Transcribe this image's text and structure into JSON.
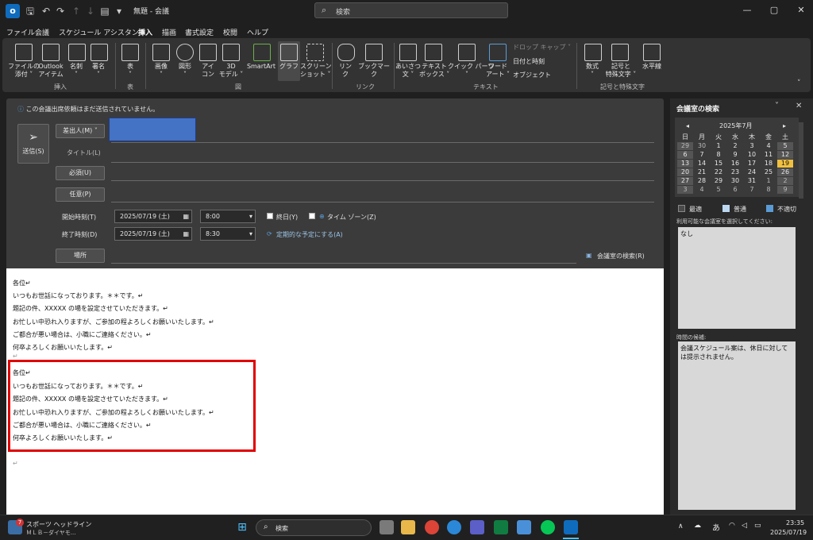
{
  "titlebar": {
    "title": "無題 - 会議",
    "search_placeholder": "検索",
    "colors": {
      "app_icon": "#0f6cbd"
    }
  },
  "menu": {
    "tabs": [
      "ファイル",
      "会議",
      "スケジュール アシスタント",
      "挿入",
      "描画",
      "書式設定",
      "校閲",
      "ヘルプ"
    ],
    "active": "挿入"
  },
  "ribbon": {
    "buttons": {
      "attach": "ファイルの\n添付 ˅",
      "outlook_item": "Outlook\nアイテム",
      "card": "名刺\n˅",
      "signature": "署名\n˅",
      "table": "表\n˅",
      "image": "画像\n˅",
      "shapes": "図形\n˅",
      "icons": "アイ\nコン",
      "model3d": "3D\nモデル ˅",
      "smartart": "SmartArt",
      "chart": "グラフ",
      "screenshot": "スクリーン\nショット ˅",
      "link": "リン\nク",
      "bookmark": "ブックマーク",
      "greeting": "あいさつ\n文 ˅",
      "textbox": "テキスト\nボックス ˅",
      "quickparts": "クイック パーツ\n˅",
      "wordart": "ワード\nアート ˅",
      "dropcap": "ドロップ キャップ ˅",
      "datetime": "日付と時刻",
      "object": "オブジェクト",
      "equation": "数式\n˅",
      "symbol": "記号と\n特殊文字 ˅",
      "hline": "水平線"
    },
    "groups": {
      "insert": "挿入",
      "table": "表",
      "figure": "図",
      "link": "リンク",
      "text": "テキスト",
      "symbols": "記号と特殊文字"
    }
  },
  "compose": {
    "info": "この会議出席依頼はまだ送信されていません。",
    "send": "送信(S)",
    "from": "差出人(M) ˅",
    "from_value_color": "#4472c4",
    "title_label": "タイトル(L)",
    "required": "必須(U)",
    "optional": "任意(P)",
    "start_label": "開始時刻(T)",
    "end_label": "終了時刻(D)",
    "start_date": "2025/07/19 (土)",
    "start_time": "8:00",
    "end_date": "2025/07/19 (土)",
    "end_time": "8:30",
    "all_day": "終日(Y)",
    "timezone": "タイム ゾーン(Z)",
    "recurring": "定期的な予定にする(A)",
    "location": "場所",
    "room_finder": "会議室の検索(R)",
    "body_lines": [
      "各位↵",
      "いつもお世話になっております。＊＊です。↵",
      "題記の件、XXXXX の場を設定させていただきます。↵",
      "お忙しい中恐れ入りますが、ご参加の程よろしくお願いいたします。↵",
      "ご都合が悪い場合は、小職にご連絡ください。↵",
      "何卒よろしくお願いいたします。↵"
    ],
    "return_mark": "↵",
    "highlight_color": "#e00000"
  },
  "room_pane": {
    "title": "会議室の検索",
    "month": "2025年7月",
    "weekdays": [
      "日",
      "月",
      "火",
      "水",
      "木",
      "金",
      "土"
    ],
    "weeks": [
      [
        "29",
        "30",
        "1",
        "2",
        "3",
        "4",
        "5"
      ],
      [
        "6",
        "7",
        "8",
        "9",
        "10",
        "11",
        "12"
      ],
      [
        "13",
        "14",
        "15",
        "16",
        "17",
        "18",
        "19"
      ],
      [
        "20",
        "21",
        "22",
        "23",
        "24",
        "25",
        "26"
      ],
      [
        "27",
        "28",
        "29",
        "30",
        "31",
        "1",
        "2"
      ],
      [
        "3",
        "4",
        "5",
        "6",
        "7",
        "8",
        "9"
      ]
    ],
    "selected_day": "19",
    "legend": [
      "最適",
      "普通",
      "不適切"
    ],
    "legend_colors": [
      "#4a4a4a",
      "#bcd7f0",
      "#5b9bd5"
    ],
    "rooms_label": "利用可能な会議室を選択してください:",
    "rooms_value": "なし",
    "suggest_label": "時間の候補:",
    "suggest_value": "会議スケジュール案は、休日に対しては提示されません。"
  },
  "taskbar": {
    "news_badge": "7",
    "news_title": "スポーツ ヘッドライン",
    "news_sub": "ＭＬＢ－ダイヤモ...",
    "search": "検索",
    "ime": "あ",
    "time": "23:35",
    "date": "2025/07/19"
  }
}
